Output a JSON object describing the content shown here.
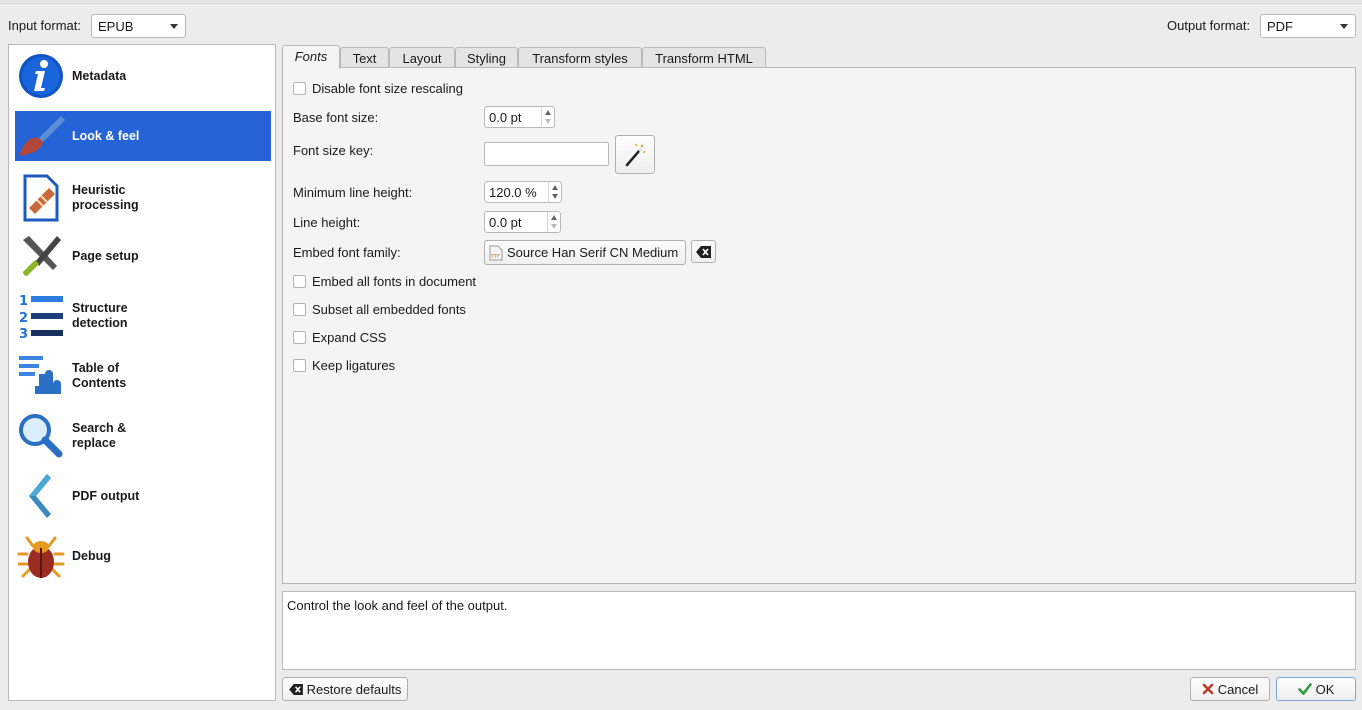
{
  "header": {
    "input_label": "Input format:",
    "input_value": "EPUB",
    "output_label": "Output format:",
    "output_value": "PDF"
  },
  "sidebar": {
    "items": [
      {
        "label": "Metadata",
        "icon": "info-icon"
      },
      {
        "label": "Look & feel",
        "icon": "brush-icon",
        "active": true
      },
      {
        "label": "Heuristic\nprocessing",
        "icon": "heuristic-doc-icon"
      },
      {
        "label": "Page setup",
        "icon": "tools-icon"
      },
      {
        "label": "Structure\ndetection",
        "icon": "numbered-list-icon"
      },
      {
        "label": "Table of\nContents",
        "icon": "toc-pointer-icon"
      },
      {
        "label": "Search &\nreplace",
        "icon": "magnifier-icon"
      },
      {
        "label": "PDF output",
        "icon": "chevron-left-icon"
      },
      {
        "label": "Debug",
        "icon": "bug-icon"
      }
    ]
  },
  "tabs": [
    "Fonts",
    "Text",
    "Layout",
    "Styling",
    "Transform styles",
    "Transform HTML"
  ],
  "fonts": {
    "disable_rescaling": "Disable font size rescaling",
    "base_font_label": "Base font size:",
    "base_font_value": "0.0 pt",
    "font_key_label": "Font size key:",
    "font_key_value": "",
    "min_line_label": "Minimum line height:",
    "min_line_value": "120.0 %",
    "line_height_label": "Line height:",
    "line_height_value": "0.0 pt",
    "embed_family_label": "Embed font family:",
    "embed_family_value": "Source Han Serif CN Medium",
    "embed_all": "Embed all fonts in document",
    "subset_all": "Subset all embedded fonts",
    "expand_css": "Expand CSS",
    "keep_ligatures": "Keep ligatures"
  },
  "description": "Control the look and feel of the output.",
  "footer": {
    "restore": "Restore defaults",
    "cancel": "Cancel",
    "ok": "OK"
  },
  "colors": {
    "selection": "#2563d6",
    "cancel_x": "#c0392b",
    "ok_check": "#2e9b3a"
  }
}
